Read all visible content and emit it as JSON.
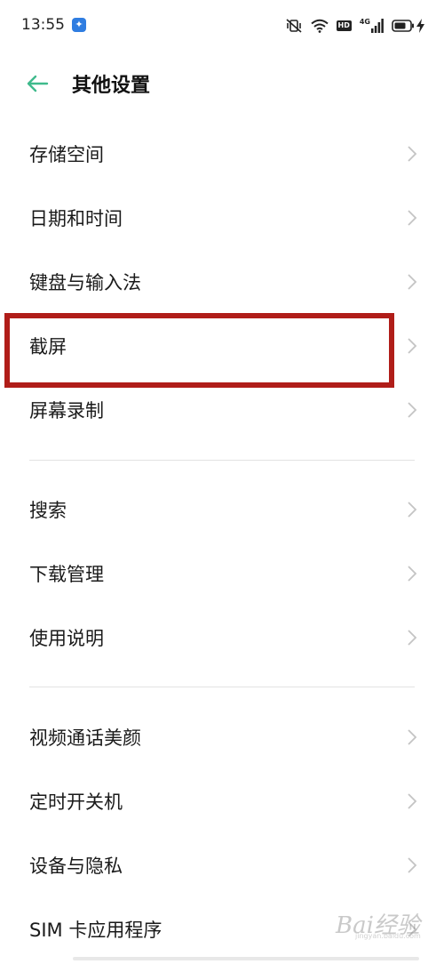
{
  "status_bar": {
    "time": "13:55",
    "notification_glyph": "✦",
    "hd_label": "HD",
    "network_label": "4G",
    "icons": [
      "vibrate-mute-icon",
      "wifi-icon",
      "hd-icon",
      "signal-icon",
      "battery-icon",
      "charging-icon"
    ]
  },
  "header": {
    "title": "其他设置",
    "back_icon": "arrow-left-icon",
    "accent_color": "#3fba8c"
  },
  "groups": [
    {
      "items": [
        {
          "label": "存储空间"
        },
        {
          "label": "日期和时间"
        },
        {
          "label": "键盘与输入法"
        },
        {
          "label": "截屏"
        },
        {
          "label": "屏幕录制"
        }
      ]
    },
    {
      "items": [
        {
          "label": "搜索"
        },
        {
          "label": "下载管理"
        },
        {
          "label": "使用说明"
        }
      ]
    },
    {
      "items": [
        {
          "label": "视频通话美颜"
        },
        {
          "label": "定时开关机"
        },
        {
          "label": "设备与隐私"
        },
        {
          "label": "SIM 卡应用程序"
        }
      ]
    }
  ],
  "highlight_color": "#b01d19",
  "watermark": {
    "text": "Bai经验",
    "url": "jingyan.baidu.com"
  }
}
